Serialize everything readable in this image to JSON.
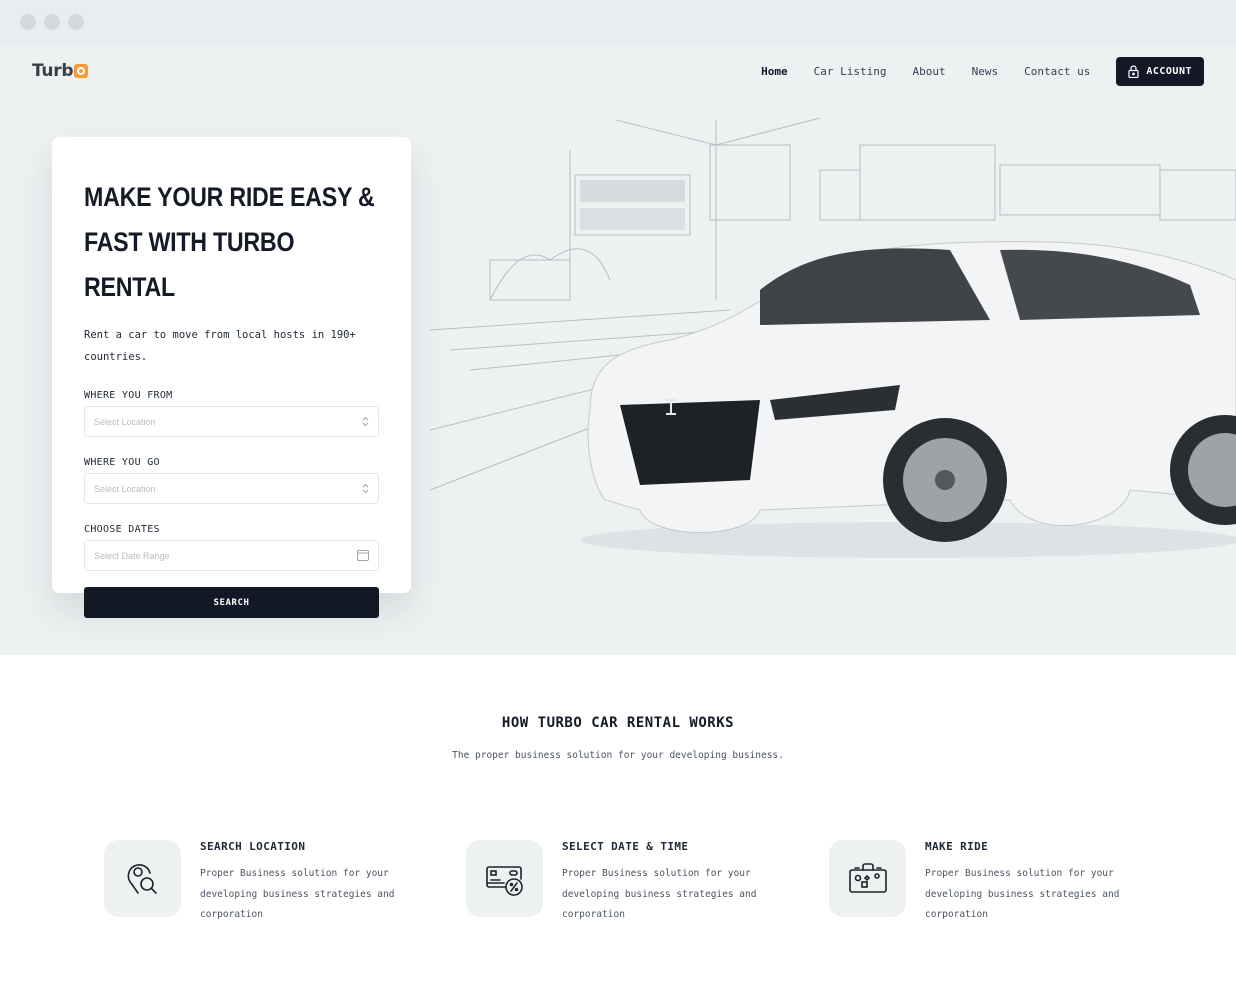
{
  "window": {
    "controls": [
      "close",
      "minimize",
      "maximize"
    ]
  },
  "header": {
    "logo": {
      "text": "Turb",
      "accent_color": "#f59a3d"
    },
    "nav": [
      {
        "label": "Home",
        "active": true
      },
      {
        "label": "Car Listing",
        "active": false
      },
      {
        "label": "About",
        "active": false
      },
      {
        "label": "News",
        "active": false
      },
      {
        "label": "Contact us",
        "active": false
      }
    ],
    "account_button": {
      "label": "ACCOUNT",
      "icon": "lock-icon"
    }
  },
  "hero": {
    "title_line1": "MAKE YOUR RIDE EASY &",
    "title_line2": "FAST WITH TURBO RENTAL",
    "description": "Rent a car to move from local hosts in 190+ countries.",
    "form": {
      "from": {
        "label": "WHERE YOU FROM",
        "placeholder": "Select Location",
        "icon": "chevron-updown-icon"
      },
      "to": {
        "label": "WHERE YOU GO",
        "placeholder": "Select Location",
        "icon": "chevron-updown-icon"
      },
      "dates": {
        "label": "CHOOSE DATES",
        "placeholder": "Select Date Range",
        "icon": "calendar-icon"
      },
      "search_label": "SEARCH"
    },
    "image": {
      "description": "white sedan with sketched highway background"
    }
  },
  "how_it_works": {
    "title": "HOW TURBO CAR RENTAL WORKS",
    "subtitle": "The proper business solution for your developing business.",
    "steps": [
      {
        "title": "SEARCH LOCATION",
        "text": "Proper Business solution for your developing business strategies and corporation",
        "icon": "location-search-icon"
      },
      {
        "title": "SELECT DATE & TIME",
        "text": "Proper Business solution for your developing business strategies and corporation",
        "icon": "card-discount-icon"
      },
      {
        "title": "MAKE RIDE",
        "text": "Proper Business solution for your developing business strategies and corporation",
        "icon": "suitcase-icon"
      }
    ]
  },
  "colors": {
    "primary_dark": "#121826",
    "hero_bg": "#eef1f2",
    "accent": "#f59a3d"
  }
}
